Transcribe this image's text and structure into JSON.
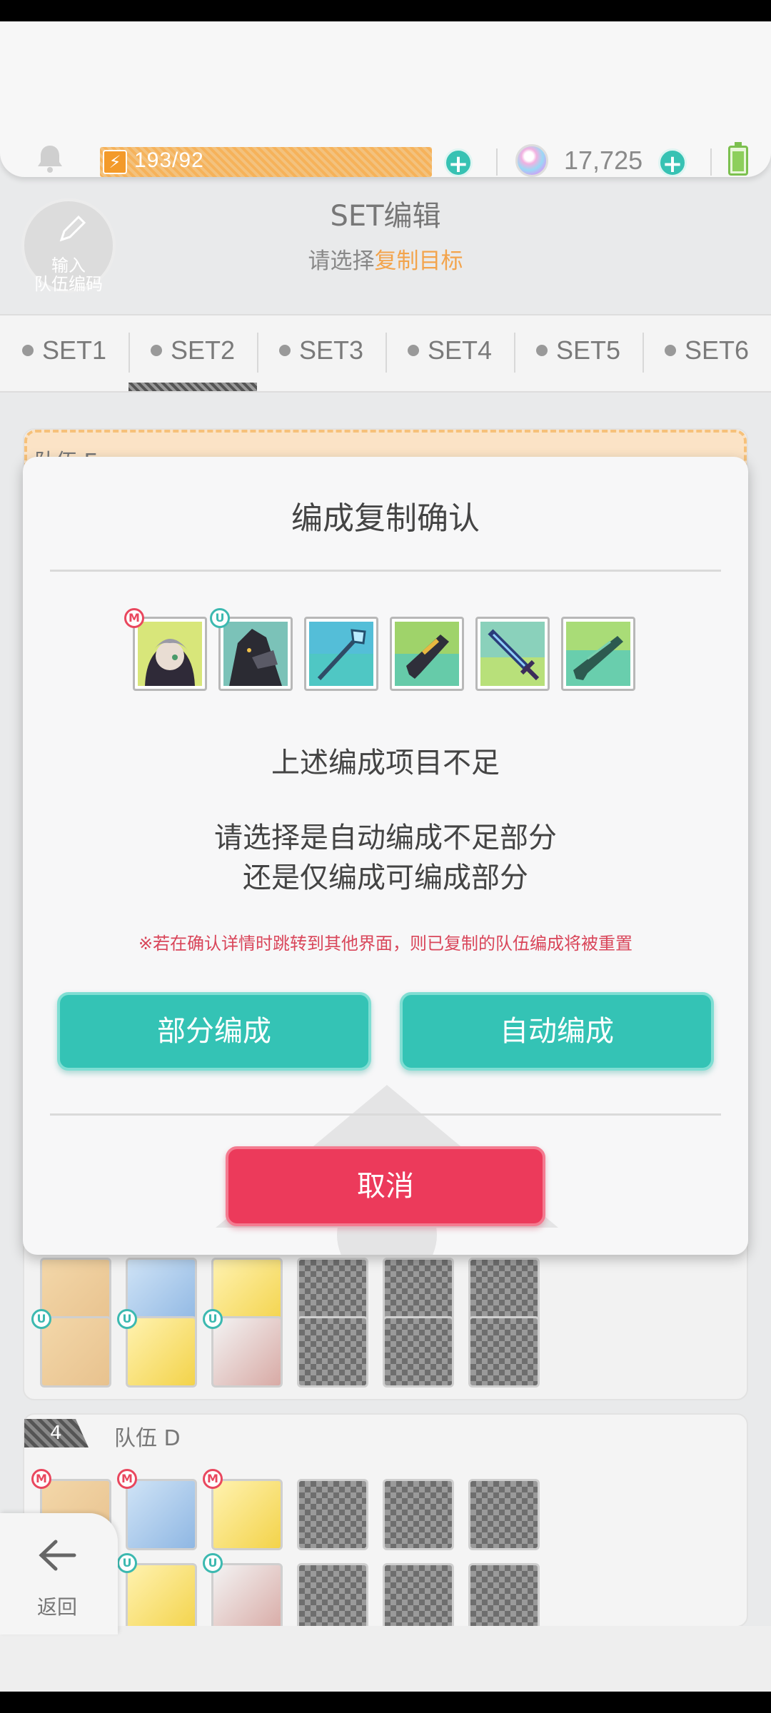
{
  "resources": {
    "stamina": "193/92",
    "gems": "17,725"
  },
  "header": {
    "title": "SET编辑",
    "subtitle_prefix": "请选择",
    "subtitle_highlight": "复制目标",
    "input_code_line1": "输入",
    "input_code_line2": "队伍编码"
  },
  "tabs": [
    {
      "label": "SET1"
    },
    {
      "label": "SET2"
    },
    {
      "label": "SET3"
    },
    {
      "label": "SET4"
    },
    {
      "label": "SET5"
    },
    {
      "label": "SET6"
    }
  ],
  "selected_tab": "SET2",
  "background": {
    "team_e_label": "队伍 E",
    "team_d_number": "4",
    "team_d_label": "队伍 D"
  },
  "dialog": {
    "title": "编成复制确认",
    "message1": "上述编成项目不足",
    "message2_line1": "请选择是自动编成不足部分",
    "message2_line2": "还是仅编成可编成部分",
    "warning": "※若在确认详情时跳转到其他界面，则已复制的队伍编成将被重置",
    "partial_button": "部分编成",
    "auto_button": "自动编成",
    "cancel_button": "取消",
    "items": [
      {
        "name": "character-m",
        "badge": "M"
      },
      {
        "name": "character-u",
        "badge": "U"
      },
      {
        "name": "spear"
      },
      {
        "name": "gun"
      },
      {
        "name": "sword"
      },
      {
        "name": "rifle"
      }
    ]
  },
  "back": {
    "label": "返回"
  },
  "colors": {
    "teal": "#34c3b5",
    "cancel_red": "#ec3a5b",
    "highlight_orange": "#f3a44c",
    "warning_red": "#d9465a"
  }
}
